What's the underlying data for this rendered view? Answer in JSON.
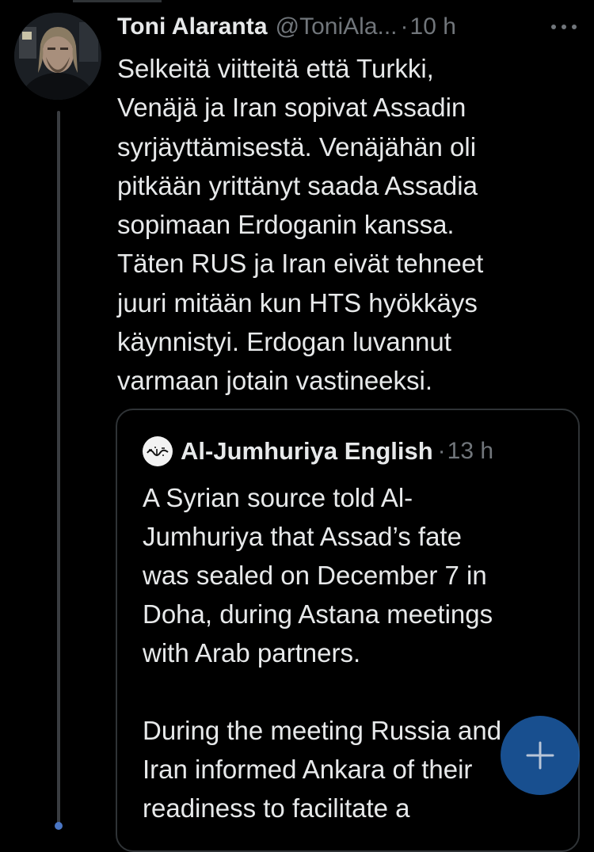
{
  "tweet": {
    "author_name": "Toni Alaranta",
    "author_handle": "@ToniAla...",
    "separator": "·",
    "time": "10 h",
    "text": "Selkeitä viitteitä että Turkki,\nVenäjä ja Iran sopivat Assadin\nsyrjäyttämisestä. Venäjähän oli\npitkään yrittänyt saada Assadia\nsopimaan Erdoganin kanssa.\nTäten RUS ja Iran eivät tehneet\njuuri mitään kun HTS hyökkäys\nkäynnistyi. Erdogan luvannut\nvarmaan jotain vastineeksi.",
    "more_icon": "more-horizontal-icon",
    "avatar_icon": "profile-photo"
  },
  "quoted_tweet": {
    "author_name": "Al-Jumhuriya English",
    "separator": "·",
    "time": "13 h",
    "text": "A Syrian source told Al-\nJumhuriya that Assad’s fate\nwas sealed on December 7 in\nDoha, during Astana meetings\nwith Arab partners.\n\nDuring the meeting Russia and\nIran informed Ankara of their\nreadiness to facilitate a",
    "avatar_icon": "calligraphy-logo"
  },
  "compose_button": {
    "icon": "plus-icon",
    "color": "#1d60af"
  },
  "colors": {
    "background": "#000000",
    "text_primary": "#e7e9ea",
    "text_secondary": "#71767b",
    "border": "#2f3336",
    "accent": "#1d9bf0"
  }
}
